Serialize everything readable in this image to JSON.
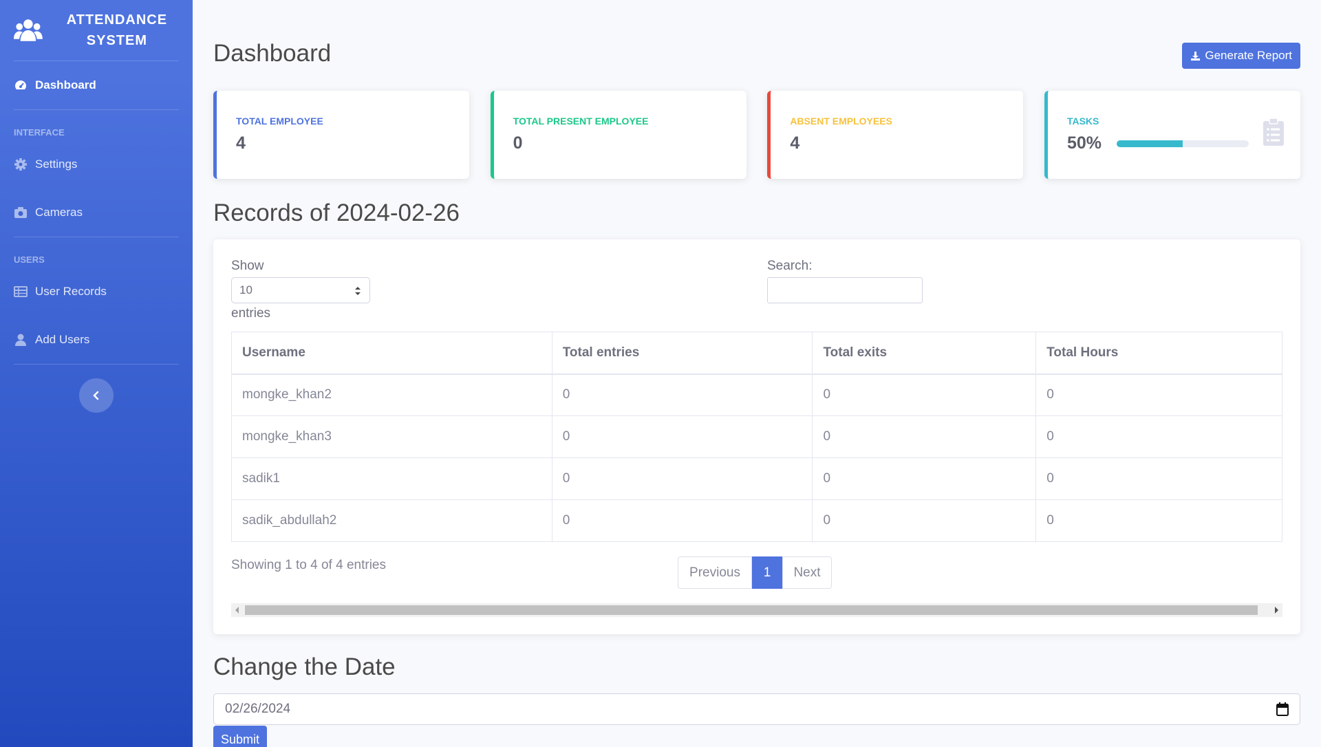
{
  "sidebar": {
    "brand": "ATTENDANCE SYSTEM",
    "dashboard": "Dashboard",
    "heading_interface": "INTERFACE",
    "settings": "Settings",
    "cameras": "Cameras",
    "heading_users": "USERS",
    "user_records": "User Records",
    "add_users": "Add Users"
  },
  "header": {
    "title": "Dashboard",
    "generate_report": "Generate Report"
  },
  "cards": {
    "total_employee": {
      "label": "TOTAL EMPLOYEE",
      "value": "4"
    },
    "total_present": {
      "label": "TOTAL PRESENT EMPLOYEE",
      "value": "0"
    },
    "absent": {
      "label": "ABSENT EMPLOYEES",
      "value": "4"
    },
    "tasks": {
      "label": "TASKS",
      "value": "50%",
      "progress": 0.5
    }
  },
  "records": {
    "title": "Records of 2024-02-26",
    "show_label": "Show",
    "page_size": "10",
    "entries_label": "entries",
    "search_label": "Search:",
    "columns": [
      "Username",
      "Total entries",
      "Total exits",
      "Total Hours"
    ],
    "rows": [
      [
        "mongke_khan2",
        "0",
        "0",
        "0"
      ],
      [
        "mongke_khan3",
        "0",
        "0",
        "0"
      ],
      [
        "sadik1",
        "0",
        "0",
        "0"
      ],
      [
        "sadik_abdullah2",
        "0",
        "0",
        "0"
      ]
    ],
    "showing": "Showing 1 to 4 of 4 entries",
    "pager": {
      "previous": "Previous",
      "current": "1",
      "next": "Next"
    }
  },
  "change_date": {
    "title": "Change the Date",
    "value": "02/26/2024",
    "submit": "Submit"
  },
  "colors": {
    "primary": "#4e73df",
    "success": "#1cc88a",
    "danger": "#e74a3b",
    "warning": "#f6c23e",
    "info": "#36b9cc"
  }
}
